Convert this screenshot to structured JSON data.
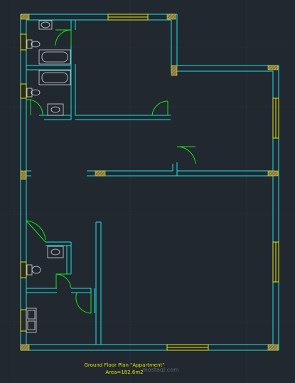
{
  "drawing": {
    "title": "Ground Floor Plan \"Appartment\"",
    "area": "Area=182.6m2",
    "watermark": "mostaql.com"
  },
  "colors": {
    "background": "#212830",
    "wall": "#19e6e6",
    "door": "#19e619",
    "window": "#e6e600",
    "fixture": "#d9d9d9",
    "column_fill": "#a08a55",
    "grid": "#2f3842",
    "caption": "#e6e100"
  },
  "fixtures": [
    "toilet",
    "washbasin",
    "bathtub",
    "kitchen-sink"
  ]
}
